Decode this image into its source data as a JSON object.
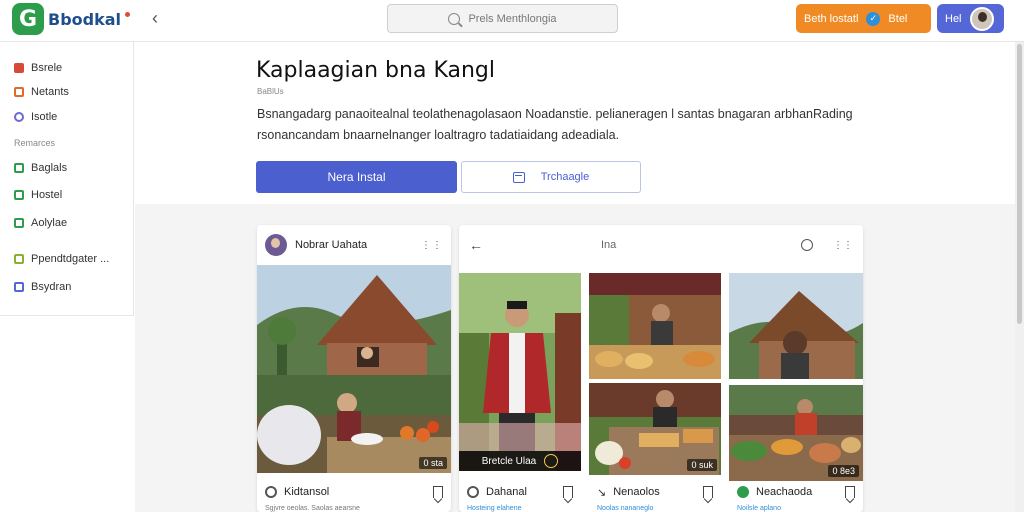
{
  "app": {
    "name": "Bbodkal",
    "logo_letter": "G"
  },
  "header": {
    "search_placeholder": "Prels Menthlongia",
    "orange_button_label": "Beth lostatl",
    "orange_button_badge": "Btel",
    "blue_button_label": "Hel"
  },
  "sidebar": {
    "items": [
      {
        "label": "Bsrele",
        "color": "#d64a3a"
      },
      {
        "label": "Netants",
        "color": "#e06a2a"
      },
      {
        "label": "Isotle",
        "color": "#6b6bd0"
      },
      {
        "label": "Baglals",
        "color": "#2e9d4b"
      },
      {
        "label": "Hostel",
        "color": "#2e9d4b"
      },
      {
        "label": "Aolylae",
        "color": "#2e9d4b"
      },
      {
        "label": "Ppendtdgater ...",
        "color": "#8bb030"
      },
      {
        "label": "Bsydran",
        "color": "#5567d6"
      }
    ],
    "section_label": "Remarces"
  },
  "main": {
    "title": "Kaplaagian bna Kangl",
    "subtitle": "BaBlUs",
    "description_line1": "Bsnangadarg panaoitealnal teolathenagolasaon Noadanstie. pelianeragen l santas bnagaran arbhanRading",
    "description_line2": "rsonancandam bnaarnelnanger loaltragro tadatiaidang adeadiala.",
    "primary_button": "Nera Instal",
    "secondary_button": "Trchaagle"
  },
  "cards": [
    {
      "author": "Nobrar Uahata",
      "footer_label": "Kidtansol",
      "footer_sub": "Sgjvre oeolas. Saolas aearsne",
      "photo_badge": "0 sta",
      "menu": "⋮⋮"
    },
    {
      "header_label": "Ina",
      "photos": [
        {
          "caption": "Bretcle Ulaa"
        },
        {
          "badge": "0 suk"
        },
        {
          "badge": "0 8e3"
        }
      ],
      "footers": [
        {
          "label": "Dahanal",
          "sub": "Hosteing elahene"
        },
        {
          "label": "Nenaolos",
          "sub": "Noolas nananeglo"
        },
        {
          "label": "Neachaoda",
          "sub": "Noilsle aplano"
        }
      ]
    }
  ],
  "colors": {
    "brand_green": "#2e9d4b",
    "accent_blue": "#4b5fcf",
    "accent_orange": "#f08a24"
  }
}
